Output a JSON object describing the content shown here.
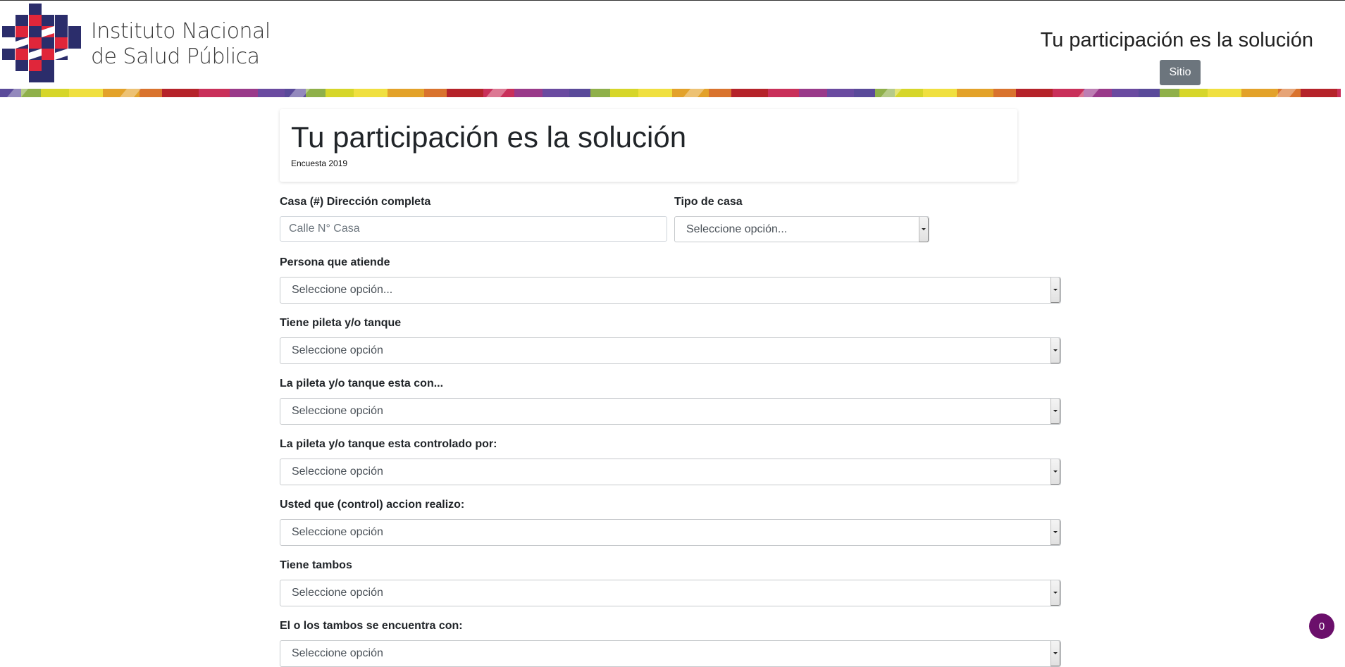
{
  "header": {
    "org_line1": "Instituto Nacional",
    "org_line2": "de Salud Pública",
    "title": "Tu participación es la solución",
    "sitio_button": "Sitio"
  },
  "card": {
    "title": "Tu participación es la solución",
    "subtitle": "Encuesta 2019"
  },
  "form": {
    "address": {
      "label": "Casa (#) Dirección completa",
      "placeholder": "Calle N° Casa",
      "value": ""
    },
    "house_type": {
      "label": "Tipo de casa",
      "selected": "Seleccione opción..."
    },
    "fields": [
      {
        "label": "Persona que atiende",
        "selected": "Seleccione opción..."
      },
      {
        "label": "Tiene pileta y/o tanque",
        "selected": "Seleccione opción"
      },
      {
        "label": "La pileta y/o tanque esta con...",
        "selected": "Seleccione opción"
      },
      {
        "label": "La pileta y/o tanque esta controlado por:",
        "selected": "Seleccione opción"
      },
      {
        "label": "Usted que (control) accion realizo:",
        "selected": "Seleccione opción"
      },
      {
        "label": "Tiene tambos",
        "selected": "Seleccione opción"
      },
      {
        "label": "El o los tambos se encuentra con:",
        "selected": "Seleccione opción"
      }
    ]
  },
  "badge": {
    "count": "0"
  },
  "colors": {
    "accent_button": "#6c757d",
    "badge": "#6b0f6b",
    "logo_navy": "#2b2d6b",
    "logo_red": "#e0263a"
  }
}
